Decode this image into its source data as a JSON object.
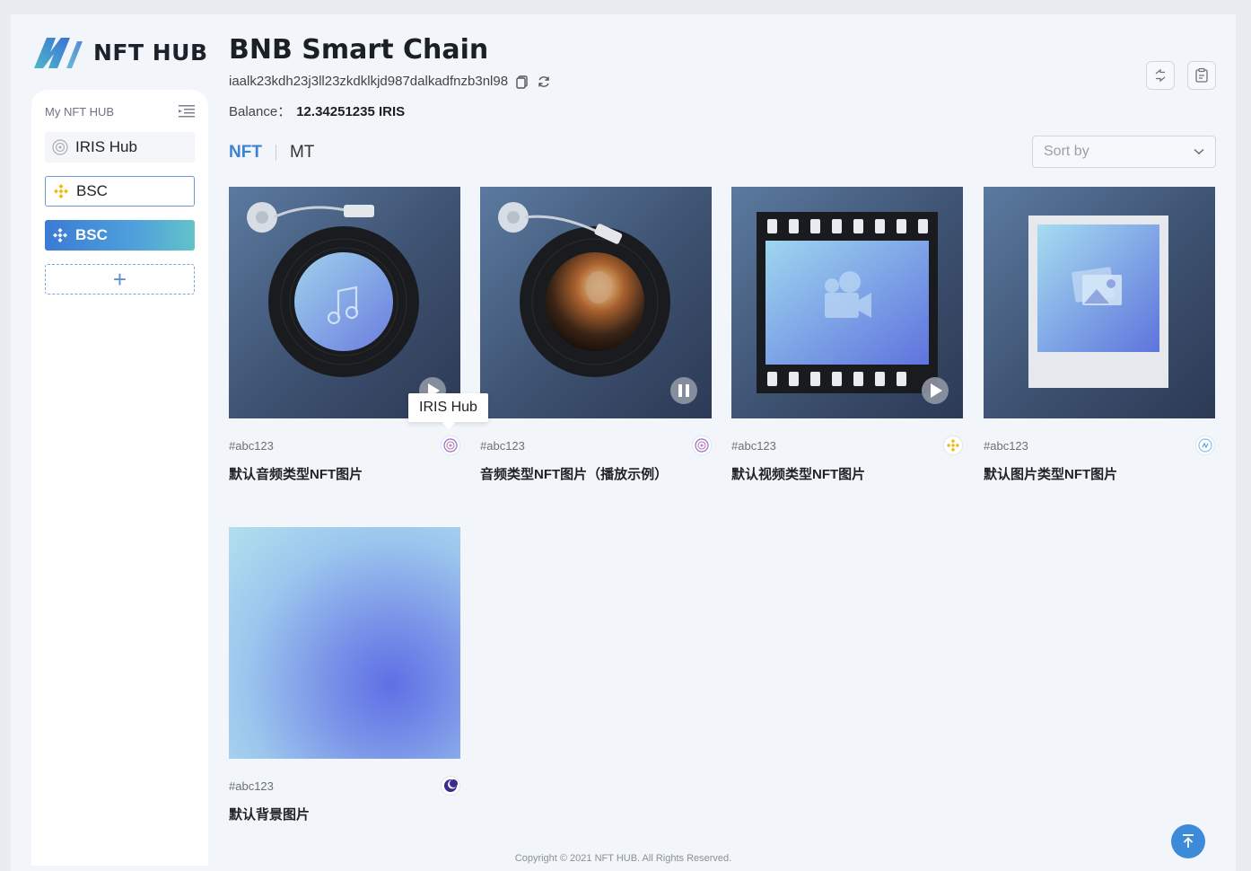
{
  "brand": {
    "name": "NFT HUB",
    "accent": "#3b82d4"
  },
  "header": {
    "chain_title": "BNB Smart Chain",
    "address": "iaalk23kdh23j3ll23zkdklkjd987dalkadfnzb3nl98",
    "balance_label": "Balance：",
    "balance_value": "12.34251235 IRIS"
  },
  "sidebar": {
    "title": "My NFT HUB",
    "items": [
      {
        "label": "IRIS Hub",
        "icon": "iris-icon",
        "state": "default"
      },
      {
        "label": "BSC",
        "icon": "bsc-icon",
        "state": "outlined"
      },
      {
        "label": "BSC",
        "icon": "bsc-icon",
        "state": "selected"
      }
    ],
    "add_label": "+"
  },
  "tabs": [
    {
      "label": "NFT",
      "active": true
    },
    {
      "label": "MT",
      "active": false
    }
  ],
  "sort": {
    "placeholder": "Sort by"
  },
  "cards": [
    {
      "id": "#abc123",
      "name": "默认音频类型NFT图片",
      "type": "audio",
      "chain_icon": "iris-icon"
    },
    {
      "id": "#abc123",
      "name": "音频类型NFT图片（播放示例）",
      "type": "audio-playing",
      "chain_icon": "iris-icon"
    },
    {
      "id": "#abc123",
      "name": "默认视频类型NFT图片",
      "type": "video",
      "chain_icon": "bsc-icon"
    },
    {
      "id": "#abc123",
      "name": "默认图片类型NFT图片",
      "type": "image",
      "chain_icon": "link-icon"
    },
    {
      "id": "#abc123",
      "name": "默认背景图片",
      "type": "background",
      "chain_icon": "moon-icon"
    }
  ],
  "tooltip": {
    "text": "IRIS Hub"
  },
  "footer": {
    "copyright": "Copyright © 2021 NFT HUB. All Rights Reserved."
  }
}
